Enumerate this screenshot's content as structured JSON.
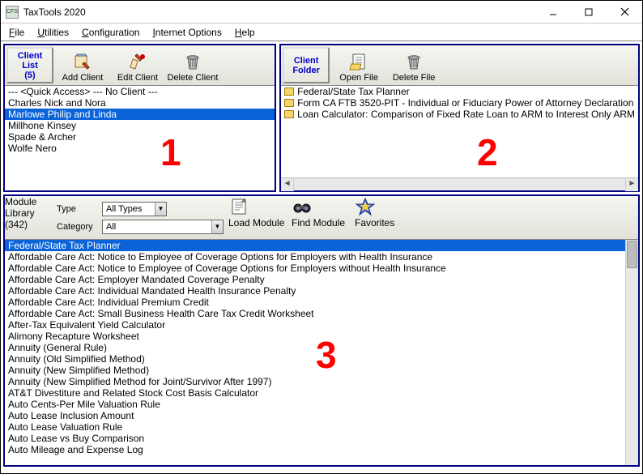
{
  "window": {
    "title": "TaxTools 2020",
    "app_icon_text": "CFS"
  },
  "menu": [
    "File",
    "Utilities",
    "Configuration",
    "Internet Options",
    "Help"
  ],
  "overlays": {
    "num1": "1",
    "num2": "2",
    "num3": "3"
  },
  "client_list": {
    "label_l1": "Client",
    "label_l2": "List",
    "count": "(5)",
    "buttons": {
      "add": "Add Client",
      "edit": "Edit Client",
      "delete": "Delete Client"
    },
    "rows": [
      "--- <Quick Access> --- No Client ---",
      "Charles Nick and Nora",
      "Marlowe Philip and Linda",
      "Millhone Kinsey",
      "Spade & Archer",
      "Wolfe Nero"
    ],
    "selected_index": 2
  },
  "client_folder": {
    "label_l1": "Client",
    "label_l2": "Folder",
    "buttons": {
      "open": "Open File",
      "delete": "Delete File"
    },
    "rows": [
      "Federal/State Tax Planner",
      "Form CA FTB 3520-PIT - Individual or Fiduciary Power of Attorney Declaration",
      "Loan Calculator: Comparison of Fixed Rate Loan to ARM to Interest Only ARM"
    ]
  },
  "module_library": {
    "label_l1": "Module",
    "label_l2": "Library",
    "count": "(342)",
    "type_label": "Type",
    "type_value": "All Types",
    "category_label": "Category",
    "category_value": "All",
    "buttons": {
      "load": "Load Module",
      "find": "Find Module",
      "fav": "Favorites"
    },
    "rows": [
      "Federal/State Tax Planner",
      "Affordable Care Act: Notice to Employee of Coverage Options for Employers with Health Insurance",
      "Affordable Care Act: Notice to Employee of Coverage Options for Employers without Health Insurance",
      "Affordable Care Act: Employer Mandated Coverage Penalty",
      "Affordable Care Act: Individual Mandated Health Insurance Penalty",
      "Affordable Care Act: Individual Premium Credit",
      "Affordable Care Act: Small Business Health Care Tax Credit Worksheet",
      "After-Tax Equivalent Yield Calculator",
      "Alimony Recapture Worksheet",
      "Annuity (General Rule)",
      "Annuity (Old Simplified Method)",
      "Annuity (New Simplified Method)",
      "Annuity (New Simplified Method for Joint/Survivor After 1997)",
      "AT&T Divestiture and Related Stock Cost Basis Calculator",
      "Auto Cents-Per Mile Valuation Rule",
      "Auto Lease Inclusion Amount",
      "Auto Lease Valuation Rule",
      "Auto Lease vs Buy Comparison",
      "Auto Mileage and Expense Log"
    ],
    "selected_index": 0
  }
}
